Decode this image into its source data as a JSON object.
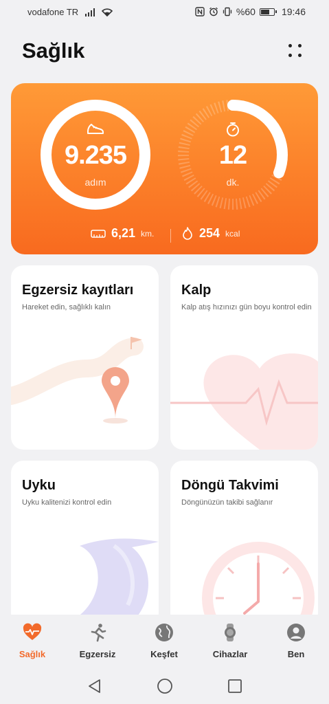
{
  "status_bar": {
    "carrier": "vodafone TR",
    "battery": "%60",
    "time": "19:46"
  },
  "header": {
    "title": "Sağlık"
  },
  "summary": {
    "steps_value": "9.235",
    "steps_unit": "adım",
    "time_value": "12",
    "time_unit": "dk.",
    "distance_value": "6,21",
    "distance_unit": "km.",
    "calories_value": "254",
    "calories_unit": "kcal"
  },
  "cards": [
    {
      "title": "Egzersiz kayıtları",
      "subtitle": "Hareket edin, sağlıklı kalın"
    },
    {
      "title": "Kalp",
      "subtitle": "Kalp atış hızınızı gün boyu kontrol edin"
    },
    {
      "title": "Uyku",
      "subtitle": "Uyku kalitenizi kontrol edin"
    },
    {
      "title": "Döngü Takvimi",
      "subtitle": "Döngünüzün takibi sağlanır"
    }
  ],
  "tabs": [
    {
      "label": "Sağlık",
      "icon": "heart-icon",
      "active": true
    },
    {
      "label": "Egzersiz",
      "icon": "runner-icon",
      "active": false
    },
    {
      "label": "Keşfet",
      "icon": "globe-icon",
      "active": false
    },
    {
      "label": "Cihazlar",
      "icon": "watch-icon",
      "active": false
    },
    {
      "label": "Ben",
      "icon": "profile-icon",
      "active": false
    }
  ],
  "colors": {
    "accent": "#f26a2b",
    "hero_top": "#ff9a37",
    "hero_bottom": "#f86a1f"
  }
}
